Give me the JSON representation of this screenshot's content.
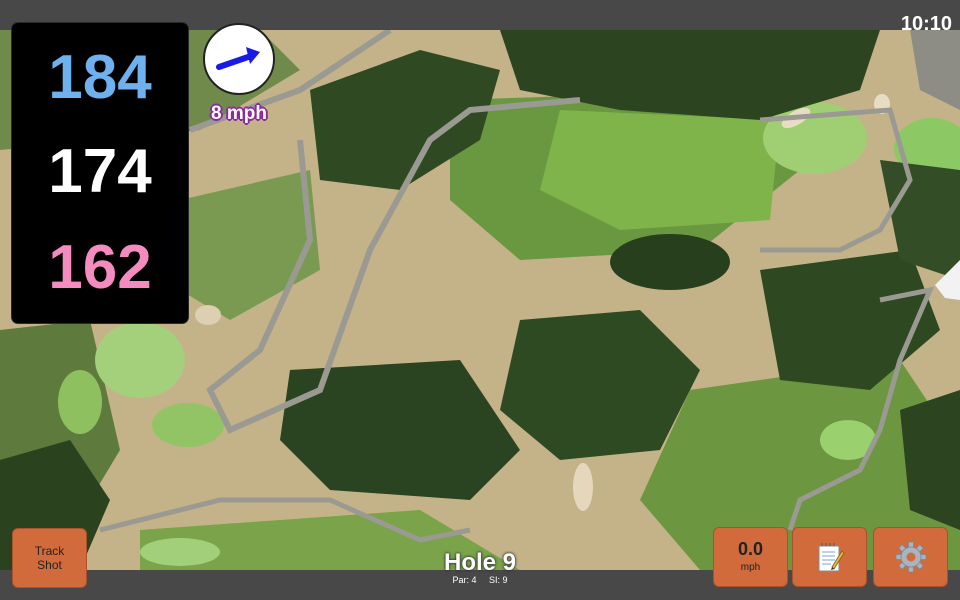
{
  "status": {
    "time": "10:10"
  },
  "distances": {
    "back": "184",
    "middle": "174",
    "front": "162"
  },
  "wind": {
    "speed_label": "8 mph"
  },
  "buttons": {
    "track_shot_line1": "Track",
    "track_shot_line2": "Shot",
    "speed_value": "0.0",
    "speed_unit": "mph"
  },
  "hole": {
    "title": "Hole 9",
    "par": "Par: 4",
    "stroke_index": "SI: 9"
  },
  "icons": {
    "wind": "arrow-icon",
    "notes": "notepad-icon",
    "settings": "gear-icon"
  },
  "colors": {
    "back_distance": "#6fb1ee",
    "middle_distance": "#ffffff",
    "front_distance": "#f58cc0",
    "button": "#d26b3c",
    "wind_arrow": "#1a1ae6"
  }
}
